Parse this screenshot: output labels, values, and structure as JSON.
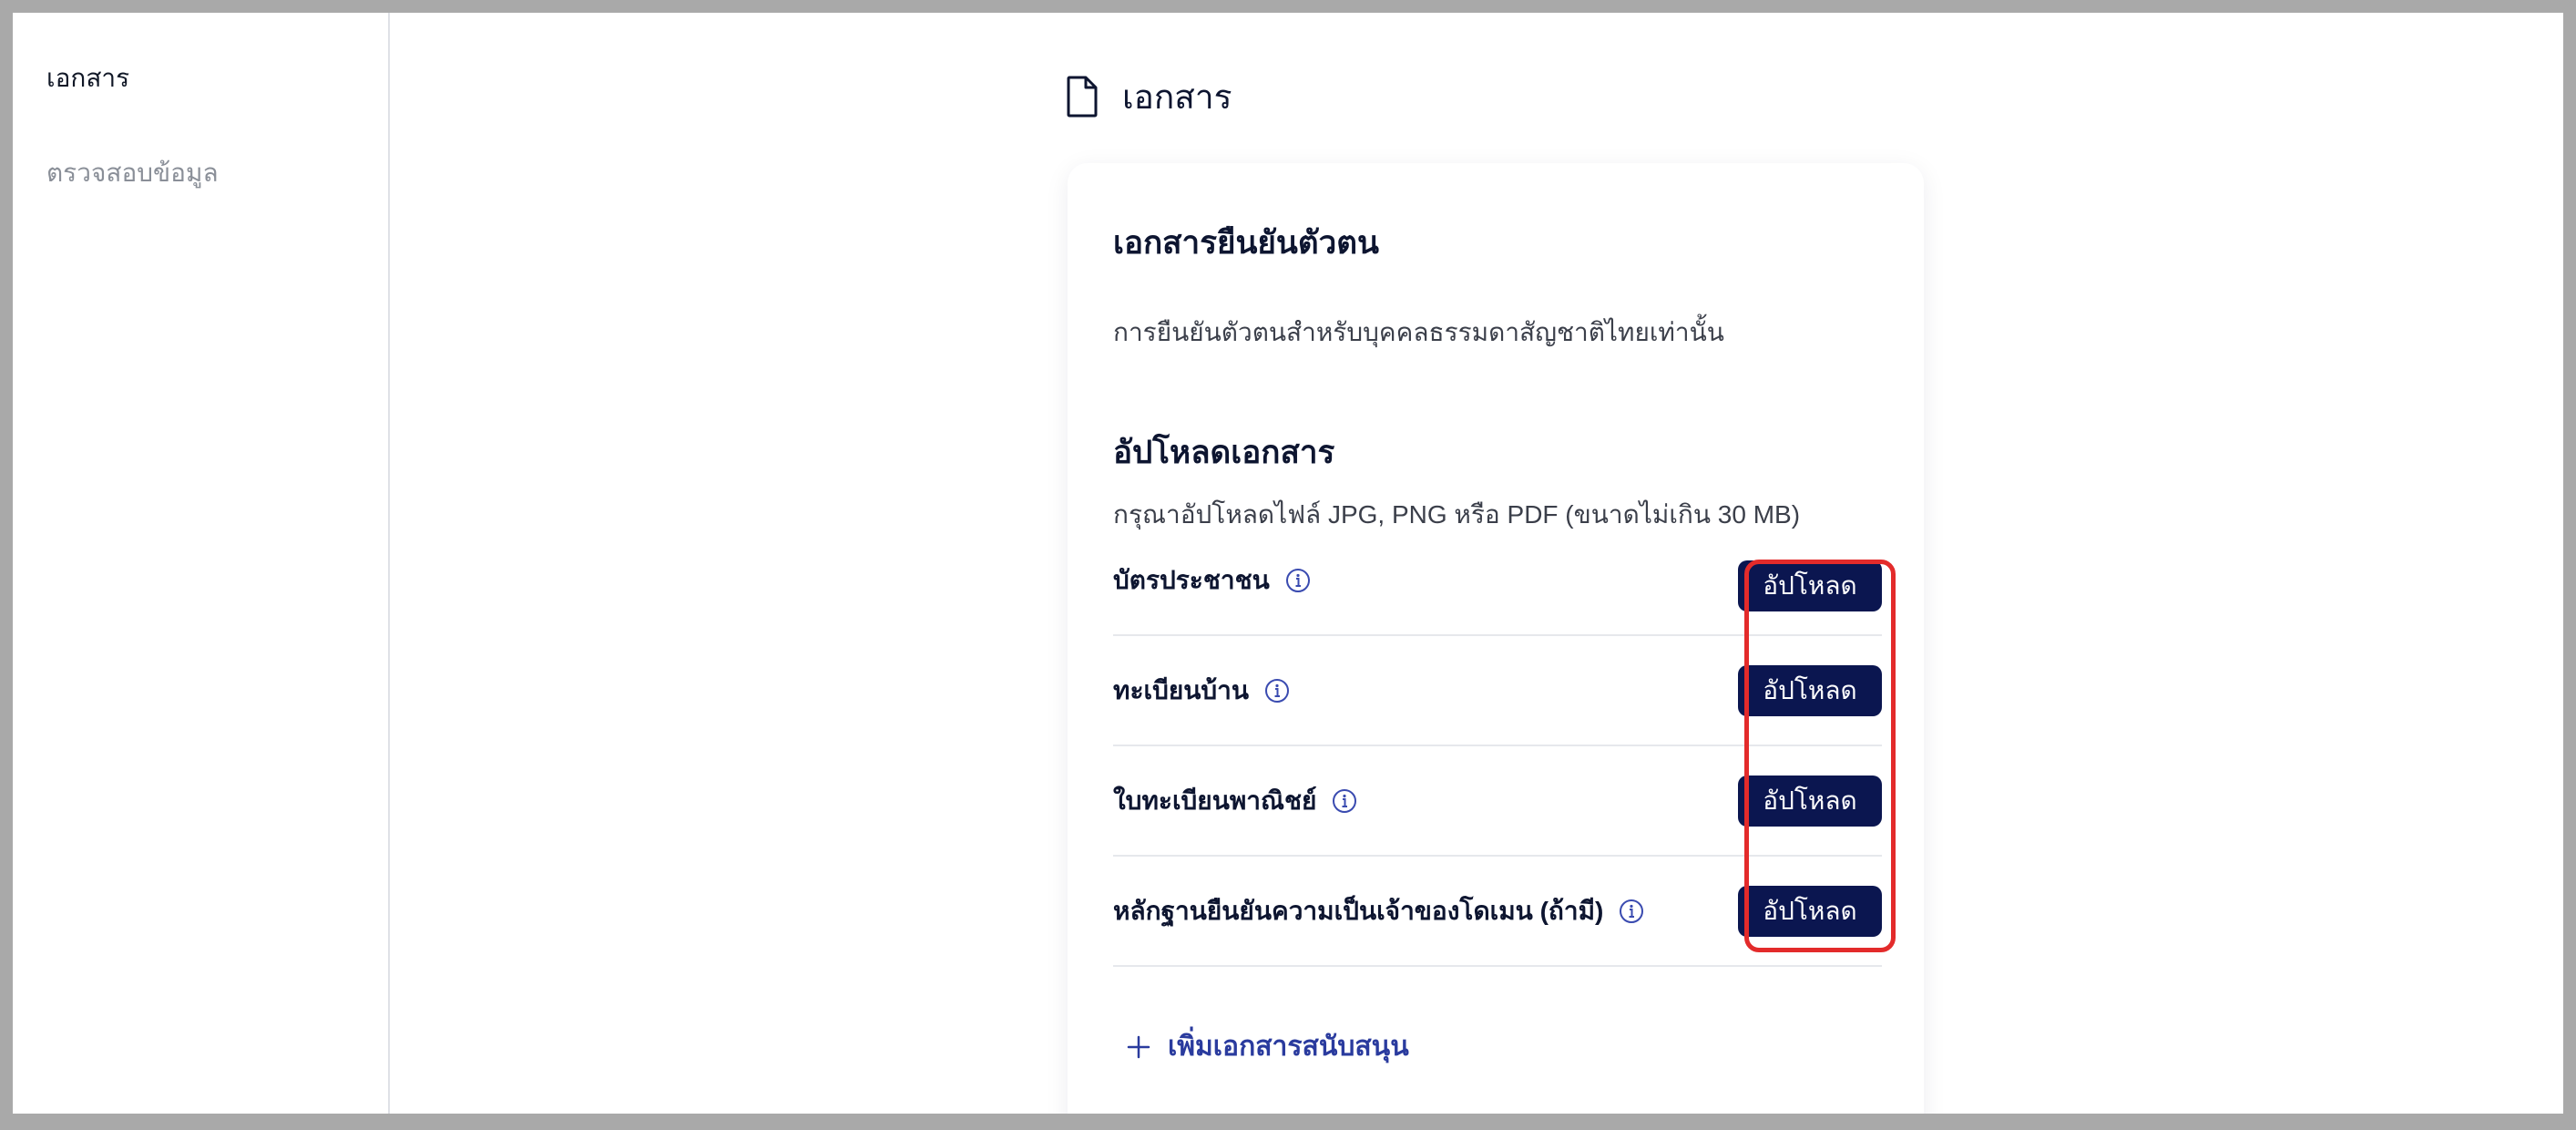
{
  "sidebar": {
    "items": [
      {
        "label": "เอกสาร",
        "active": true
      },
      {
        "label": "ตรวจสอบข้อมูล",
        "active": false
      }
    ]
  },
  "main": {
    "title": "เอกสาร",
    "title_icon": "document-icon"
  },
  "card": {
    "title": "เอกสารยืนยันตัวตน",
    "description": "การยืนยันตัวตนสำหรับบุคคลธรรมดาสัญชาติไทยเท่านั้น",
    "upload_section": {
      "title": "อัปโหลดเอกสาร",
      "hint": "กรุณาอัปโหลดไฟล์ JPG, PNG หรือ PDF (ขนาดไม่เกิน 30 MB)",
      "documents": [
        {
          "label": "บัตรประชาชน",
          "button": "อัปโหลด",
          "icon": "info-icon"
        },
        {
          "label": "ทะเบียนบ้าน",
          "button": "อัปโหลด",
          "icon": "info-icon"
        },
        {
          "label": "ใบทะเบียนพาณิชย์",
          "button": "อัปโหลด",
          "icon": "info-icon"
        },
        {
          "label": "หลักฐานยืนยันความเป็นเจ้าของโดเมน (ถ้ามี)",
          "button": "อัปโหลด",
          "icon": "info-icon"
        }
      ]
    },
    "add_support": {
      "label": "เพิ่มเอกสารสนับสนุน",
      "icon": "plus-icon"
    }
  },
  "colors": {
    "primary_button": "#0b1650",
    "link": "#2a3b9e",
    "highlight": "#e32b2b"
  }
}
